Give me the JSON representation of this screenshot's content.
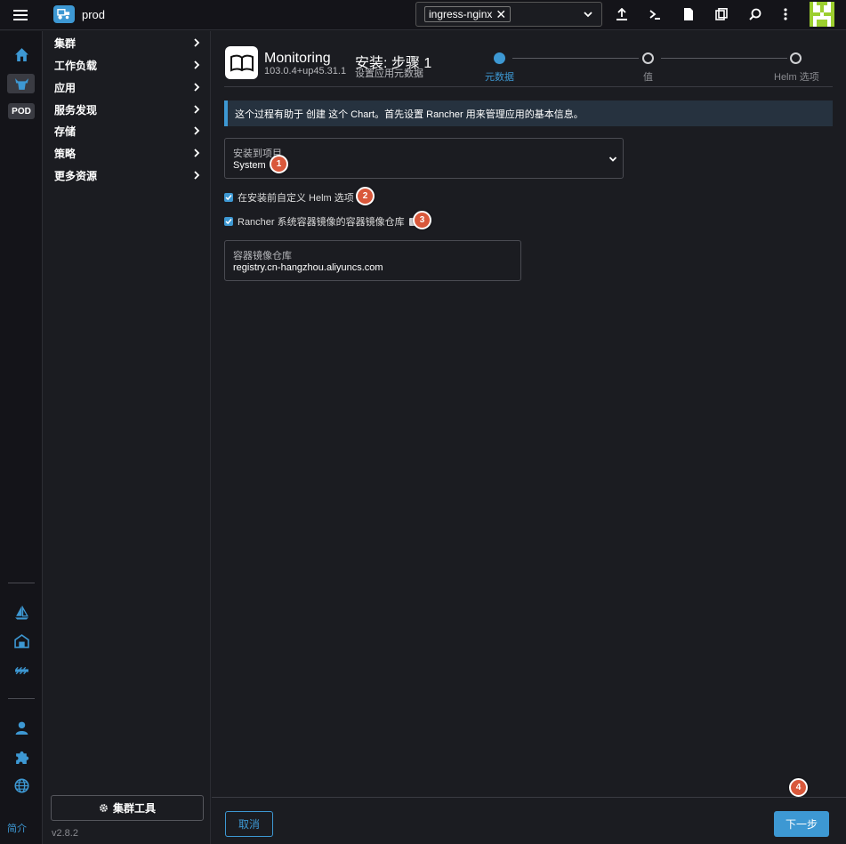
{
  "topbar": {
    "cluster_name": "prod",
    "namespace_chip": "ingress-nginx",
    "namespace_chip_remove": "✕",
    "icons": [
      "menu-icon",
      "cluster-icon",
      "upload-icon",
      "shell-icon",
      "file-icon",
      "copy-icon",
      "search-icon",
      "more-vertical-icon",
      "user-avatar"
    ]
  },
  "leftrail": {
    "pod_badge": "POD",
    "bottom_link": "简介",
    "icons": [
      "home-icon",
      "cattle-icon",
      "fleet-sail-icon",
      "warehouse-icon",
      "tractor-icon",
      "user-icon",
      "extensions-icon",
      "globe-icon"
    ]
  },
  "sidenav": {
    "items": [
      {
        "label": "集群"
      },
      {
        "label": "工作负载"
      },
      {
        "label": "应用"
      },
      {
        "label": "服务发现"
      },
      {
        "label": "存储"
      },
      {
        "label": "策略"
      },
      {
        "label": "更多资源"
      }
    ],
    "cluster_tools": "集群工具",
    "version": "v2.8.2"
  },
  "header": {
    "app_title": "Monitoring",
    "app_version": "103.0.4+up45.31.1",
    "step_title": "安装: 步骤 1",
    "step_subtitle": "设置应用元数据"
  },
  "wizard": {
    "steps": [
      {
        "label": "元数据",
        "active": true
      },
      {
        "label": "值",
        "active": false
      },
      {
        "label": "Helm 选项",
        "active": false
      }
    ]
  },
  "banner": {
    "text": "这个过程有助于 创建 这个 Chart。首先设置 Rancher 用来管理应用的基本信息。"
  },
  "form": {
    "project_label": "安装到项目",
    "project_value": "System",
    "customize_helm_label": "在安装前自定义 Helm 选项",
    "customize_helm_checked": true,
    "registry_checkbox_label": "Rancher 系统容器镜像的容器镜像仓库",
    "registry_checkbox_checked": true,
    "registry_field_label": "容器镜像仓库",
    "registry_field_value": "registry.cn-hangzhou.aliyuncs.com"
  },
  "markers": [
    "1",
    "2",
    "3",
    "4"
  ],
  "footer": {
    "cancel_label": "取消",
    "next_label": "下一步"
  },
  "colors": {
    "accent": "#3d98d3",
    "marker": "#d9583b",
    "background": "#1b1c21",
    "header_bg": "#141419"
  }
}
